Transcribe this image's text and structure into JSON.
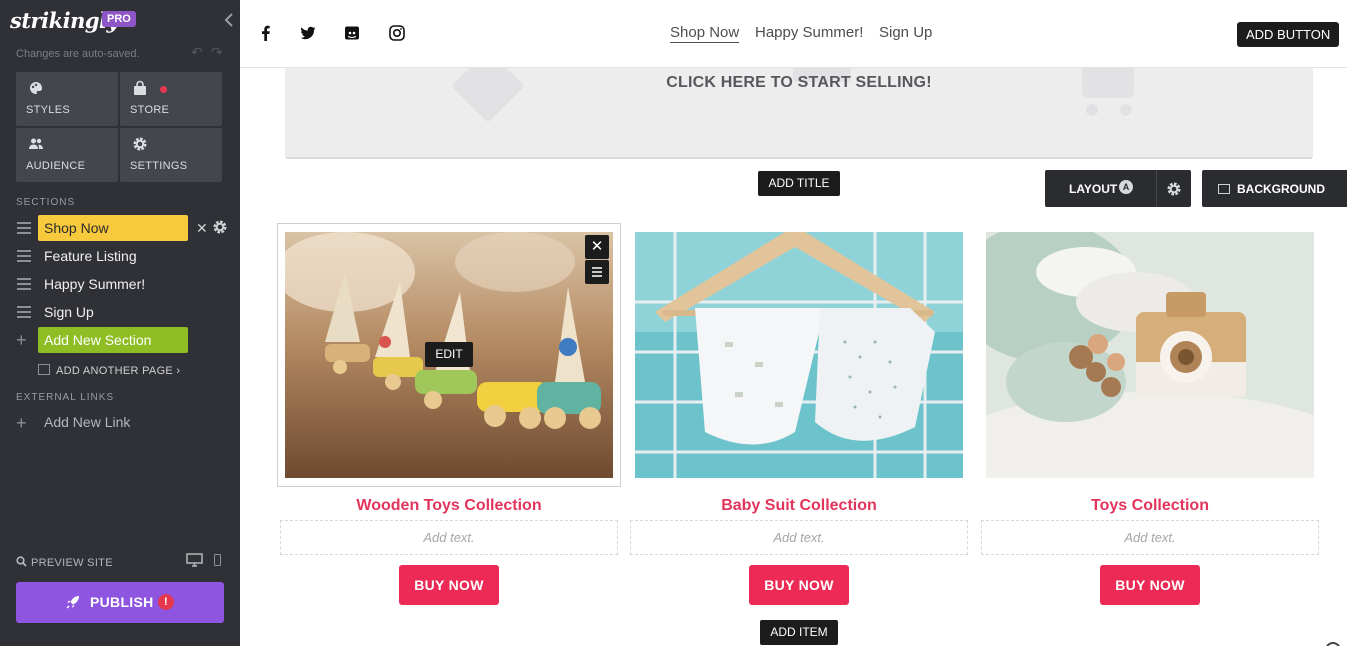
{
  "sidebar": {
    "logo": "strikingly",
    "badge": "PRO",
    "autosave": "Changes are auto-saved.",
    "tiles": {
      "styles": "STYLES",
      "store": "STORE",
      "audience": "AUDIENCE",
      "settings": "SETTINGS"
    },
    "sections_heading": "SECTIONS",
    "sections": [
      {
        "label": "Shop Now"
      },
      {
        "label": "Feature Listing"
      },
      {
        "label": "Happy Summer!"
      },
      {
        "label": "Sign Up"
      }
    ],
    "add_section": "Add New Section",
    "add_page": "ADD ANOTHER PAGE",
    "external_heading": "EXTERNAL LINKS",
    "add_link": "Add New Link",
    "preview": "PREVIEW SITE",
    "publish": "PUBLISH",
    "publish_alert": "!"
  },
  "topbar": {
    "nav": [
      "Shop Now",
      "Happy Summer!",
      "Sign Up"
    ],
    "add_button": "ADD BUTTON"
  },
  "content": {
    "banner_text": "CLICK HERE TO START SELLING!",
    "add_title": "ADD TITLE",
    "layout": "LAYOUT",
    "layout_badge": "A",
    "background": "BACKGROUND",
    "edit": "EDIT",
    "add_item": "ADD ITEM",
    "products": [
      {
        "title": "Wooden Toys Collection",
        "desc_placeholder": "Add text.",
        "button": "BUY NOW"
      },
      {
        "title": "Baby Suit Collection",
        "desc_placeholder": "Add text.",
        "button": "BUY NOW"
      },
      {
        "title": "Toys Collection",
        "desc_placeholder": "Add text.",
        "button": "BUY NOW"
      }
    ]
  },
  "colors": {
    "sidebar_bg": "#2f3136",
    "active_section": "#f7c93d",
    "add_section": "#8fbd24",
    "publish": "#8e55e0",
    "product_title": "#e3345c",
    "buy_button": "#ec2a55"
  }
}
